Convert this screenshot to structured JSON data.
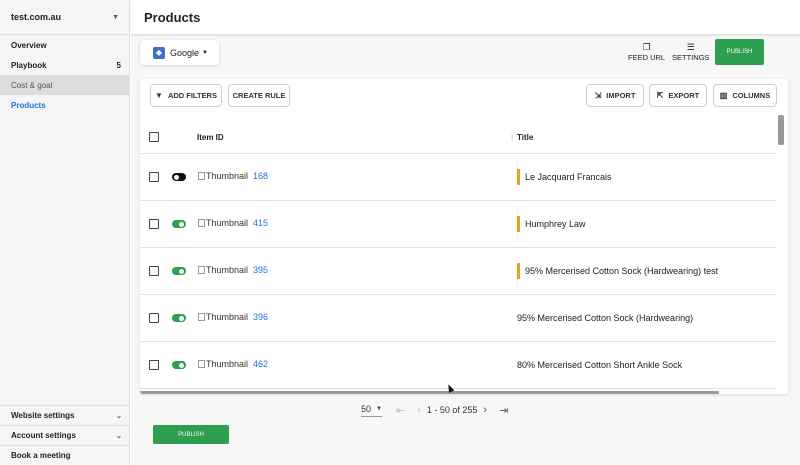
{
  "sidebar": {
    "site": "test.com.au",
    "items": [
      {
        "label": "Overview"
      },
      {
        "label": "Playbook",
        "count": "5"
      },
      {
        "label": "Cost & goal"
      },
      {
        "label": "Products"
      }
    ],
    "bottom": [
      {
        "label": "Website settings"
      },
      {
        "label": "Account settings"
      },
      {
        "label": "Book a meeting"
      }
    ]
  },
  "header": {
    "title": "Products"
  },
  "toolbar": {
    "channel": "Google",
    "feed_url": "FEED URL",
    "settings": "SETTINGS",
    "publish": "PUBLISH"
  },
  "actions": {
    "add_filters": "ADD FILTERS",
    "create_rule": "CREATE RULE",
    "import": "IMPORT",
    "export": "EXPORT",
    "columns": "COLUMNS"
  },
  "table": {
    "columns": [
      "Item ID",
      "Title"
    ],
    "thumbnail_alt": "Thumbnail",
    "rows": [
      {
        "enabled": false,
        "id": "168",
        "title": "Le Jacquard Francais",
        "flag": true
      },
      {
        "enabled": true,
        "id": "415",
        "title": "Humphrey Law",
        "flag": true
      },
      {
        "enabled": true,
        "id": "395",
        "title": "95% Mercerised Cotton Sock (Hardwearing) test",
        "flag": true
      },
      {
        "enabled": true,
        "id": "396",
        "title": "95% Mercerised Cotton Sock (Hardwearing)",
        "flag": false
      },
      {
        "enabled": true,
        "id": "462",
        "title": "80% Mercerised Cotton Short Ankle Sock",
        "flag": false
      }
    ]
  },
  "pagination": {
    "per_page": "50",
    "range": "1 - 50 of 255"
  },
  "footer": {
    "publish": "PUBLISH"
  },
  "colors": {
    "accent_green": "#2e9e4f",
    "link_blue": "#1a73e8",
    "flag_orange": "#f0a020"
  }
}
